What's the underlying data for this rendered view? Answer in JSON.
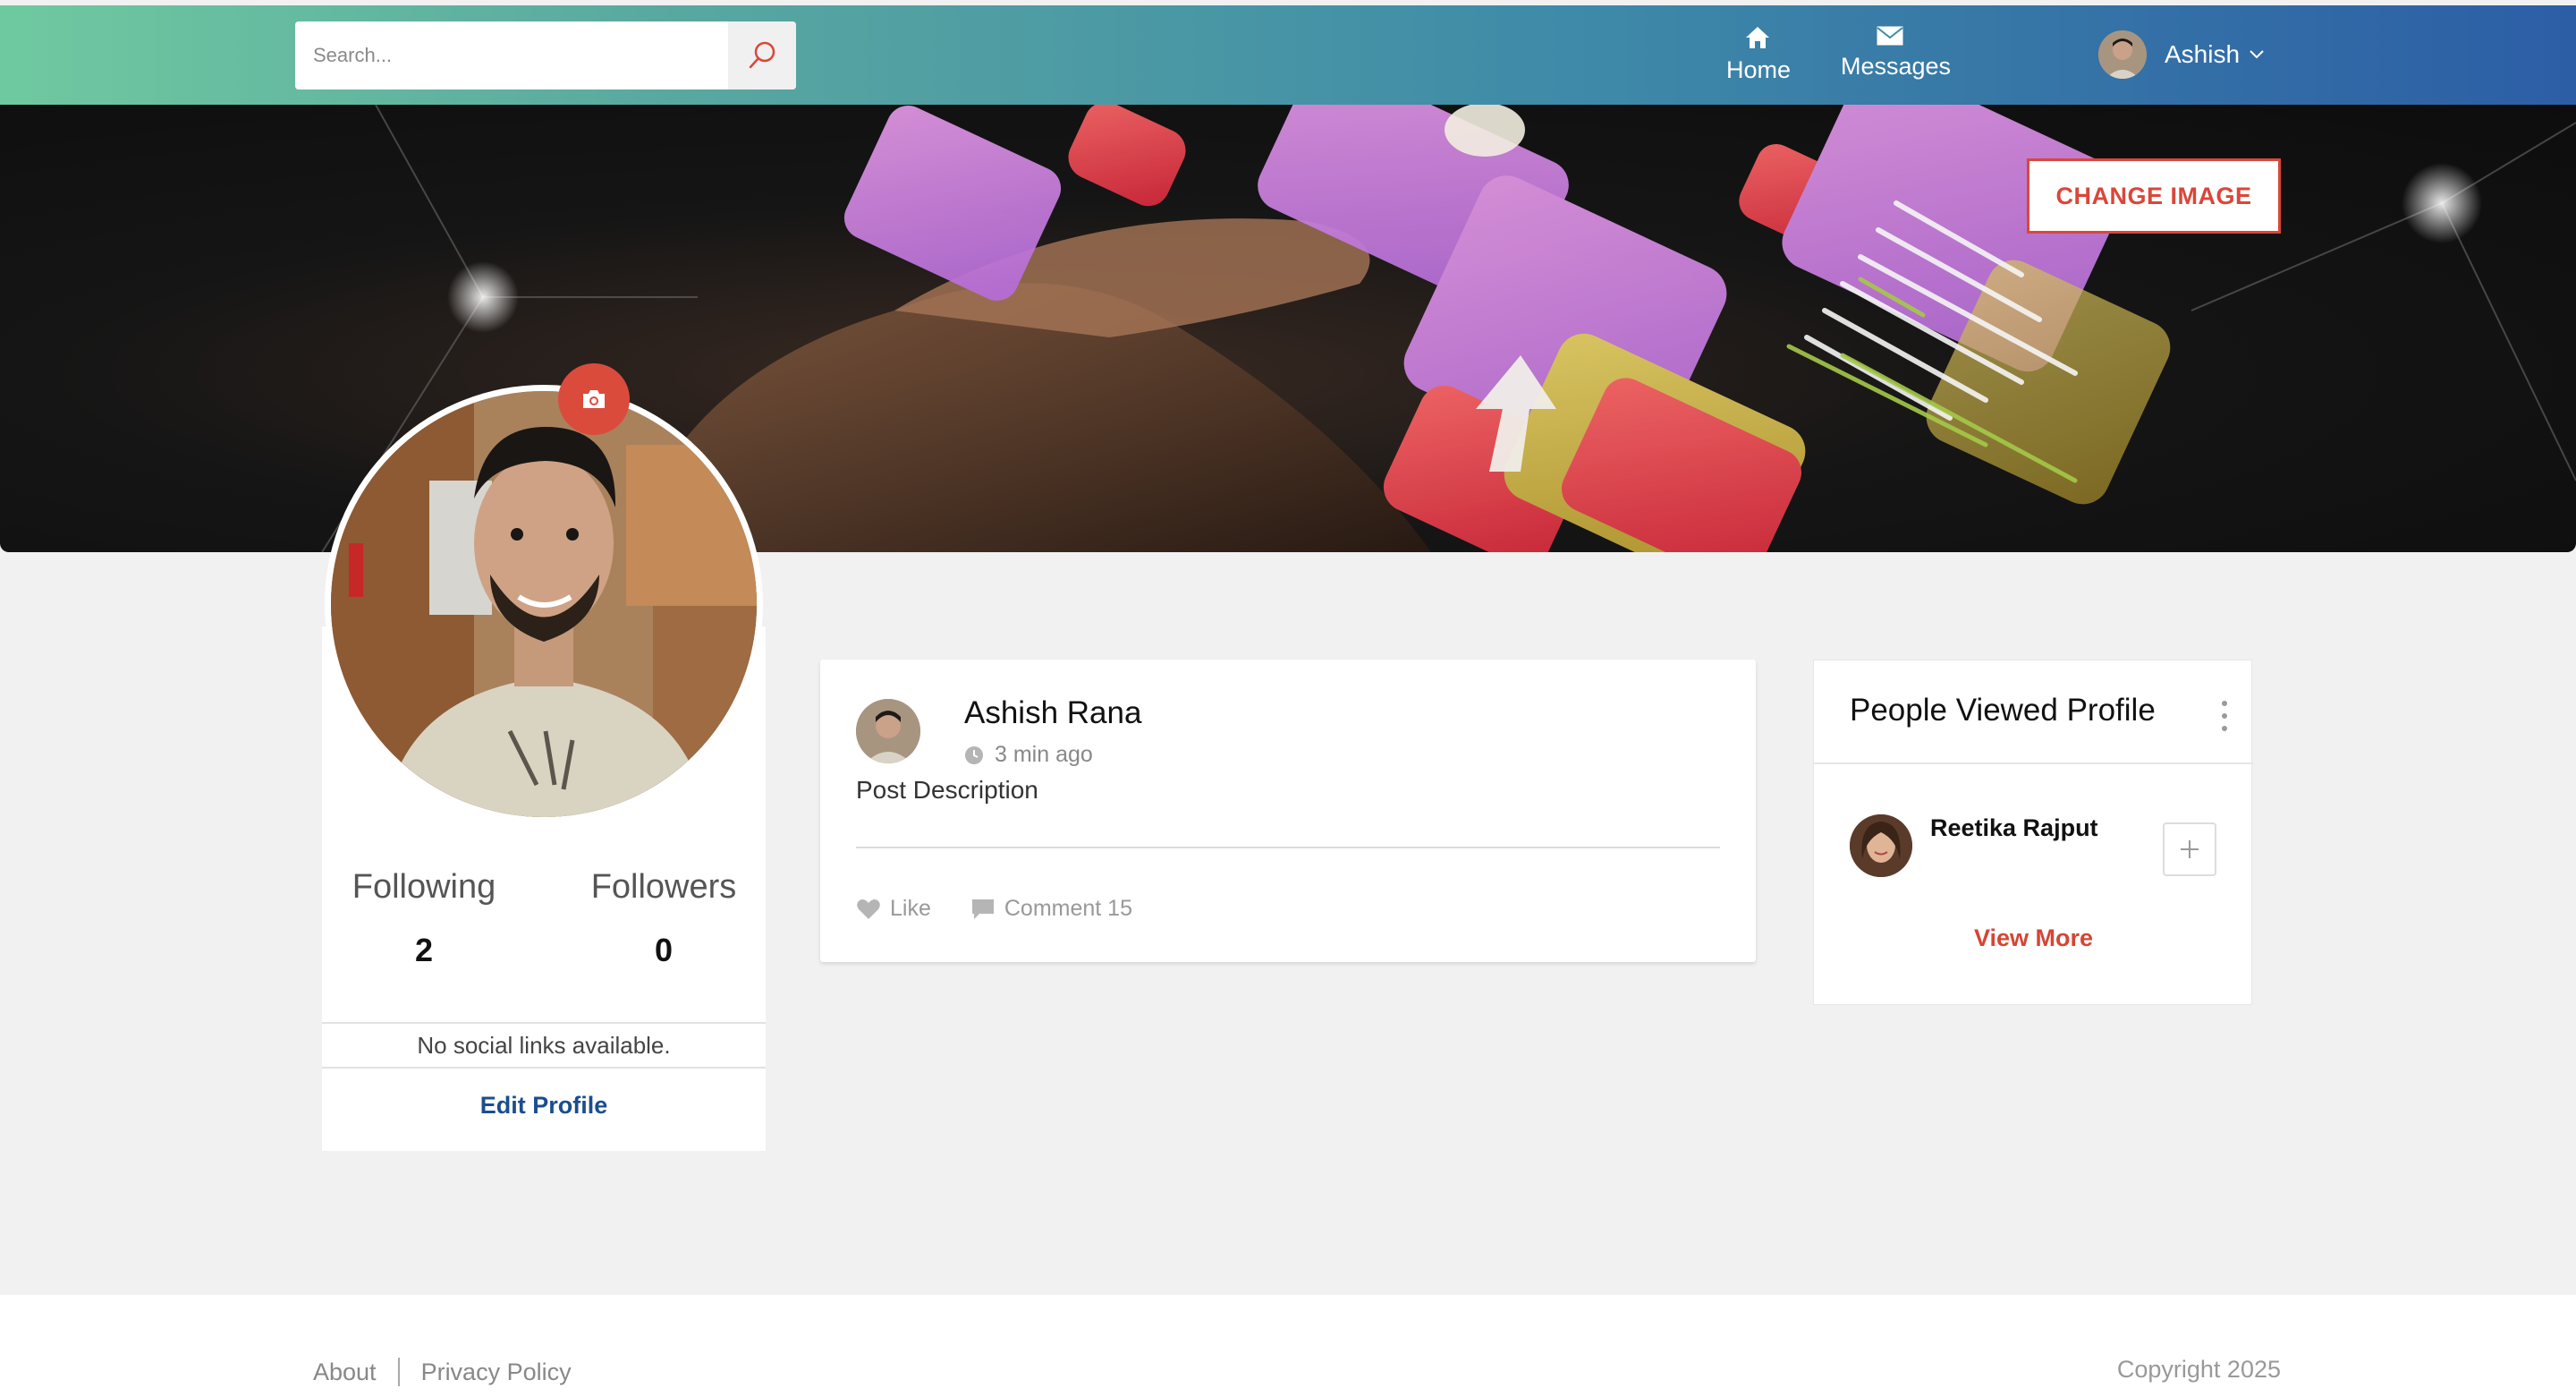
{
  "navbar": {
    "search_placeholder": "Search...",
    "home_label": "Home",
    "messages_label": "Messages",
    "user_name": "Ashish"
  },
  "banner": {
    "change_image_label": "CHANGE IMAGE"
  },
  "profile": {
    "following_label": "Following",
    "following_count": "2",
    "followers_label": "Followers",
    "followers_count": "0",
    "social_text": "No social links available.",
    "edit_label": "Edit Profile"
  },
  "post": {
    "author": "Ashish Rana",
    "time": "3 min ago",
    "description": "Post Description",
    "like_label": "Like",
    "comment_label": "Comment 15"
  },
  "viewed": {
    "title": "People Viewed Profile",
    "viewers": [
      {
        "name": "Reetika Rajput"
      }
    ],
    "view_more_label": "View More"
  },
  "footer": {
    "links": [
      "About",
      "Privacy Policy"
    ],
    "copyright": "Copyright 2025"
  },
  "colors": {
    "accent": "#d9473a",
    "link_blue": "#1b4d8f",
    "nav_gradient_start": "#6fc9a0",
    "nav_gradient_end": "#2c5ea6"
  }
}
